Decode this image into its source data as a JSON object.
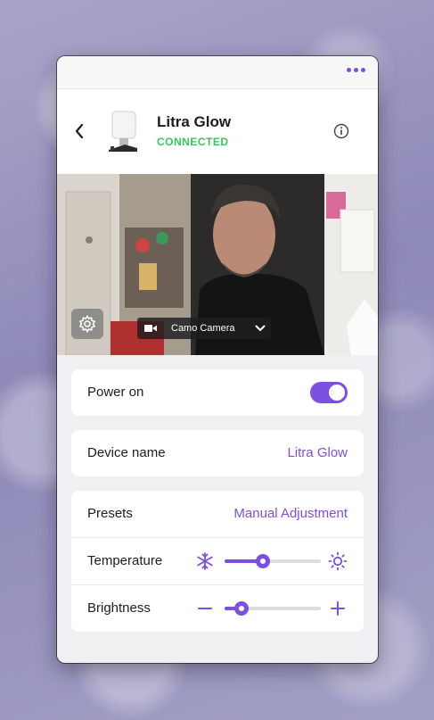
{
  "device": {
    "name": "Litra Glow",
    "status": "CONNECTED"
  },
  "camera": {
    "selected": "Camo Camera"
  },
  "power": {
    "label": "Power on",
    "on": true
  },
  "device_name_row": {
    "label": "Device name",
    "value": "Litra Glow"
  },
  "presets": {
    "label": "Presets",
    "value": "Manual Adjustment"
  },
  "temperature": {
    "label": "Temperature",
    "level": 0.4
  },
  "brightness": {
    "label": "Brightness",
    "level": 0.18
  },
  "colors": {
    "accent": "#7b4fe0",
    "status_connected": "#35c759"
  },
  "icons": [
    "more-icon",
    "back-icon",
    "info-icon",
    "gear-icon",
    "video-camera-icon",
    "chevron-down-icon",
    "snowflake-icon",
    "sun-icon",
    "minus-icon",
    "plus-icon"
  ]
}
